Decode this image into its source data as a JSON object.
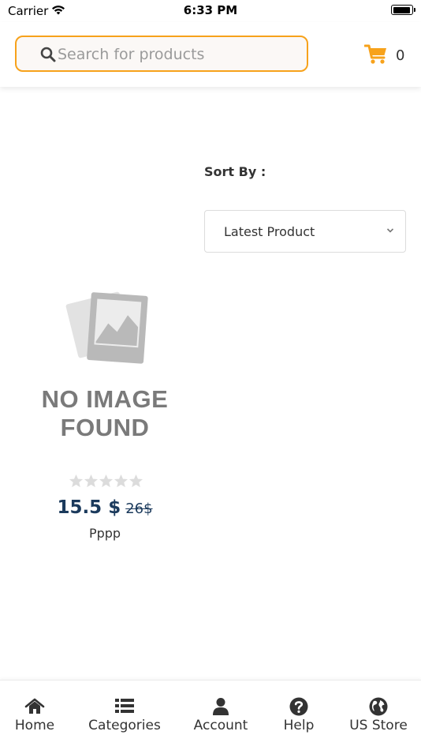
{
  "status_bar": {
    "carrier": "Carrier",
    "time": "6:33 PM"
  },
  "header": {
    "search_placeholder": "Search for products",
    "search_value": "",
    "cart_count": "0"
  },
  "sort": {
    "label": "Sort By :",
    "selected": "Latest Product"
  },
  "product": {
    "image_text_line1": "NO IMAGE",
    "image_text_line2": "FOUND",
    "price": "15.5 $",
    "old_price": "26$",
    "name": "Pppp",
    "rating": 0,
    "max_rating": 5
  },
  "bottom_nav": {
    "items": [
      {
        "label": "Home",
        "icon": "home-icon"
      },
      {
        "label": "Categories",
        "icon": "list-icon"
      },
      {
        "label": "Account",
        "icon": "user-icon"
      },
      {
        "label": "Help",
        "icon": "question-icon"
      },
      {
        "label": "US Store",
        "icon": "globe-icon"
      }
    ]
  },
  "colors": {
    "accent": "#f7a21b",
    "price": "#1b3a5c",
    "star_empty": "#dcdcdc"
  }
}
